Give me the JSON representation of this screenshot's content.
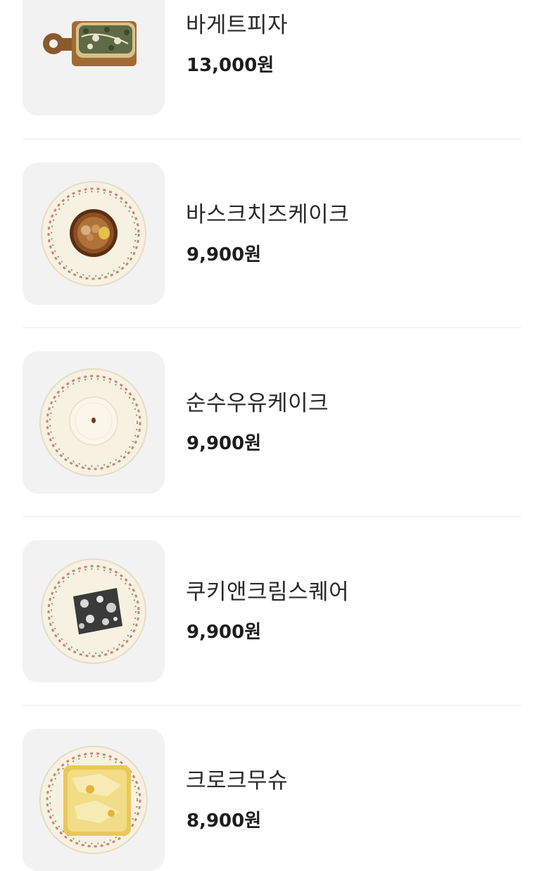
{
  "menu": {
    "items": [
      {
        "name": "바게트피자",
        "price": "13,000원",
        "image_icon": "baguette-pizza-photo"
      },
      {
        "name": "바스크치즈케이크",
        "price": "9,900원",
        "image_icon": "basque-cheesecake-photo"
      },
      {
        "name": "순수우유케이크",
        "price": "9,900원",
        "image_icon": "milk-cake-photo"
      },
      {
        "name": "쿠키앤크림스퀘어",
        "price": "9,900원",
        "image_icon": "cookies-cream-square-photo"
      },
      {
        "name": "크로크무슈",
        "price": "8,900원",
        "image_icon": "croque-monsieur-photo"
      }
    ]
  },
  "colors": {
    "text_primary": "#2a2a2a",
    "price_text": "#1d1d1d",
    "divider": "#ececec",
    "thumb_bg": "#f1f1f1"
  }
}
